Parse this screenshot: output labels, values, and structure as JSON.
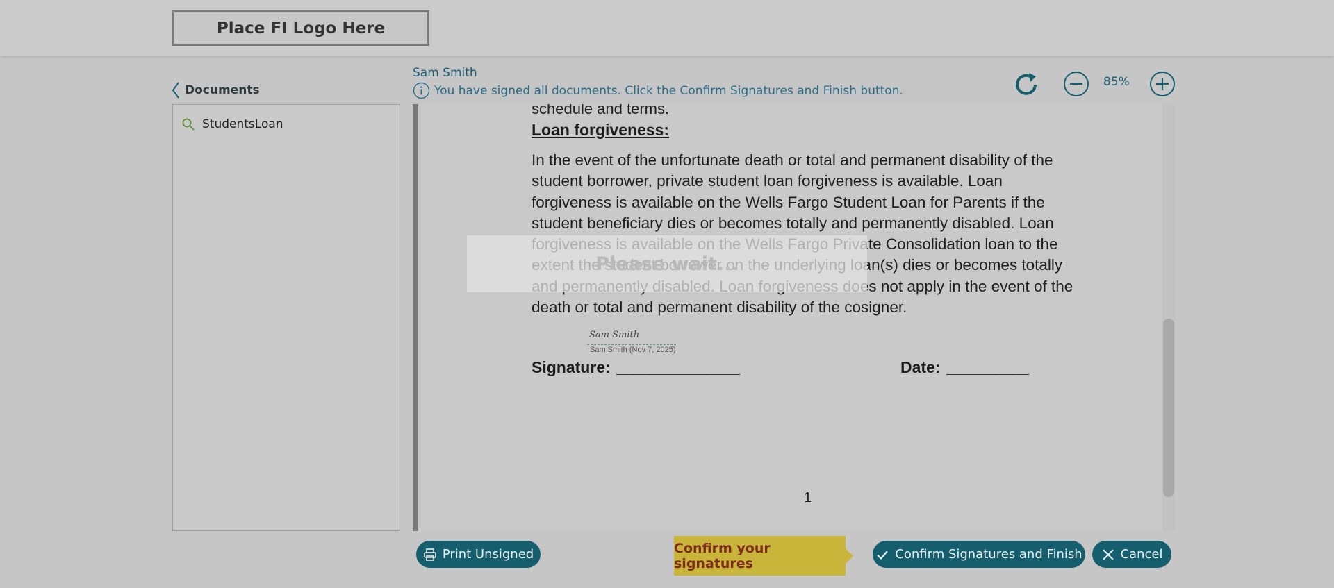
{
  "header": {
    "logo_text": "Place FI Logo Here"
  },
  "sidebar": {
    "back_label": "Documents",
    "documents": [
      {
        "label": "StudentsLoan"
      }
    ]
  },
  "toolbar": {
    "user_name": "Sam Smith",
    "info_message": "You have signed all documents. Click the Confirm Signatures and Finish button.",
    "zoom_level": "85%"
  },
  "document": {
    "top_line": "schedule and terms.",
    "heading": "Loan forgiveness:",
    "paragraph": "In the event of the unfortunate death or total and permanent disability of the student borrower, private student loan forgiveness is available. Loan forgiveness is available on the Wells Fargo Student Loan for Parents if the student beneficiary dies or becomes totally and permanently disabled. Loan forgiveness is available on the Wells Fargo Private Consolidation loan to the extent the student borrower on the underlying loan(s) dies or becomes totally and permanently disabled. Loan forgiveness does not apply in the event of the death or total and permanent disability of the cosigner.",
    "signature_label": "Signature:",
    "signature_line": "_______________",
    "date_label": "Date:",
    "date_line": "__________",
    "signature_script": "Sam Smith",
    "signature_stamp": "Sam Smith (Nov 7, 2025)",
    "page_number": "1",
    "scroll_position": 0.75
  },
  "overlay": {
    "wait_text": "Please wait..."
  },
  "footer": {
    "print_label": "Print Unsigned",
    "tooltip_text": "Confirm your signatures",
    "confirm_label": "Confirm Signatures and Finish",
    "cancel_label": "Cancel"
  },
  "colors": {
    "accent": "#155e6e",
    "tooltip_bg": "#c8b53a",
    "tooltip_text": "#7c2b1c",
    "link": "#2a6d8a"
  },
  "icons": {
    "back": "chevron-left-icon",
    "search": "search-icon",
    "info": "info-icon",
    "refresh": "refresh-icon",
    "zoom_out": "minus-circle-icon",
    "zoom_in": "plus-circle-icon",
    "print": "printer-icon",
    "confirm": "checkmark-icon",
    "cancel": "close-icon"
  }
}
